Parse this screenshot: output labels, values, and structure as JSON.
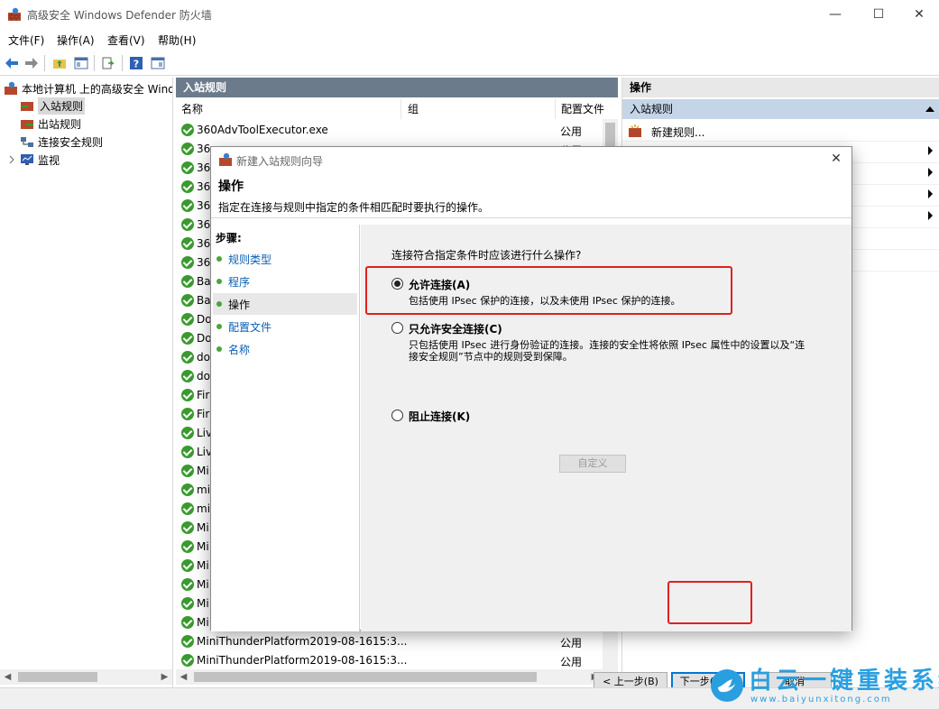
{
  "window": {
    "title": "高级安全 Windows Defender 防火墙",
    "minimize": "—",
    "maximize": "☐",
    "close": "✕"
  },
  "menu": [
    {
      "label": "文件(F)"
    },
    {
      "label": "操作(A)"
    },
    {
      "label": "查看(V)"
    },
    {
      "label": "帮助(H)"
    }
  ],
  "tree": {
    "root": "本地计算机 上的高级安全 Windows Defender 防火墙",
    "items": [
      {
        "label": "入站规则"
      },
      {
        "label": "出站规则"
      },
      {
        "label": "连接安全规则"
      },
      {
        "label": "监视"
      }
    ]
  },
  "center": {
    "header": "入站规则",
    "columns": {
      "name": "名称",
      "group": "组",
      "profile": "配置文件"
    },
    "rows": [
      {
        "name": "360AdvToolExecutor.exe",
        "profile": "公用"
      },
      {
        "name": "36",
        "profile": "公用"
      },
      {
        "name": "36",
        "profile": ""
      },
      {
        "name": "36",
        "profile": ""
      },
      {
        "name": "36",
        "profile": ""
      },
      {
        "name": "36",
        "profile": ""
      },
      {
        "name": "36",
        "profile": ""
      },
      {
        "name": "36",
        "profile": ""
      },
      {
        "name": "Ba",
        "profile": ""
      },
      {
        "name": "Ba",
        "profile": ""
      },
      {
        "name": "Do",
        "profile": ""
      },
      {
        "name": "Do",
        "profile": ""
      },
      {
        "name": "do",
        "profile": ""
      },
      {
        "name": "do",
        "profile": ""
      },
      {
        "name": "Fir",
        "profile": ""
      },
      {
        "name": "Fir",
        "profile": ""
      },
      {
        "name": "Liv",
        "profile": ""
      },
      {
        "name": "Liv",
        "profile": ""
      },
      {
        "name": "Mi",
        "profile": ""
      },
      {
        "name": "mi",
        "profile": ""
      },
      {
        "name": "mi",
        "profile": ""
      },
      {
        "name": "Mi",
        "profile": ""
      },
      {
        "name": "Mi",
        "profile": ""
      },
      {
        "name": "Mi",
        "profile": ""
      },
      {
        "name": "Mi",
        "profile": ""
      },
      {
        "name": "Mi",
        "profile": ""
      },
      {
        "name": "Mi",
        "profile": ""
      },
      {
        "name": "MiniThunderPlatform2019-08-1615:3...",
        "profile": "公用"
      },
      {
        "name": "MiniThunderPlatform2019-08-1615:3...",
        "profile": "公用"
      }
    ]
  },
  "actions": {
    "header": "操作",
    "section": "入站规则",
    "items": [
      {
        "label": "新建规则..."
      }
    ]
  },
  "dialog": {
    "title": "新建入站规则向导",
    "close": "✕",
    "heading": "操作",
    "subtitle": "指定在连接与规则中指定的条件相匹配时要执行的操作。",
    "steps_title": "步骤:",
    "steps": [
      {
        "label": "规则类型"
      },
      {
        "label": "程序"
      },
      {
        "label": "操作"
      },
      {
        "label": "配置文件"
      },
      {
        "label": "名称"
      }
    ],
    "question": "连接符合指定条件时应该进行什么操作?",
    "options": [
      {
        "label": "允许连接(A)",
        "desc": "包括使用 IPsec 保护的连接，以及未使用 IPsec 保护的连接。"
      },
      {
        "label": "只允许安全连接(C)",
        "desc": "只包括使用 IPsec 进行身份验证的连接。连接的安全性将依照 IPsec 属性中的设置以及“连接安全规则”节点中的规则受到保障。"
      },
      {
        "label": "阻止连接(K)",
        "desc": ""
      }
    ],
    "custom_button": "自定义",
    "back_button": "< 上一步(B)",
    "next_button": "下一步(N) >",
    "cancel_button": "取消"
  },
  "watermark": {
    "text": "白云一键重装系统",
    "url": "www.baiyunxitong.com"
  },
  "colors": {
    "accent": "#0078d7",
    "annotation": "#e02020",
    "check_green": "#3a9a2f",
    "pane_header": "#6b7b8c"
  }
}
